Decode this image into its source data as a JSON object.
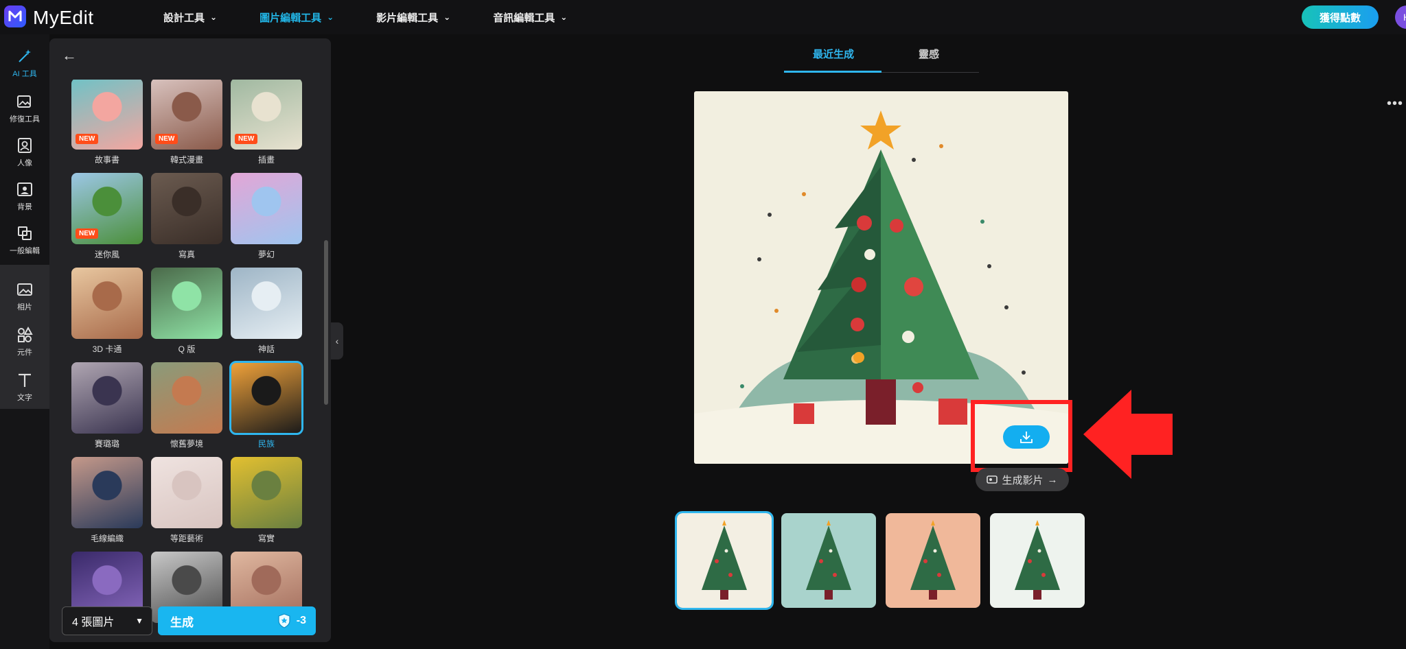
{
  "app": {
    "name": "MyEdit"
  },
  "topnav": {
    "items": [
      {
        "label": "設計工具",
        "active": false
      },
      {
        "label": "圖片編輯工具",
        "active": true
      },
      {
        "label": "影片編輯工具",
        "active": false
      },
      {
        "label": "音訊編輯工具",
        "active": false
      }
    ],
    "points_label": "獲得點數",
    "avatar_initial": "H"
  },
  "leftrail": {
    "items": [
      {
        "label": "AI 工具",
        "icon": "magic-wand-icon",
        "active": true
      },
      {
        "label": "修復工具",
        "icon": "image-repair-icon"
      },
      {
        "label": "人像",
        "icon": "portrait-icon"
      },
      {
        "label": "背景",
        "icon": "background-icon"
      },
      {
        "label": "一般編輯",
        "icon": "crop-icon"
      },
      {
        "label": "相片",
        "icon": "photo-icon"
      },
      {
        "label": "元件",
        "icon": "shapes-icon"
      },
      {
        "label": "文字",
        "icon": "text-icon"
      }
    ]
  },
  "styles": {
    "items": [
      {
        "label": "故事書",
        "new": true,
        "colors": [
          "#6fc2c6",
          "#f3a6a0"
        ]
      },
      {
        "label": "韓式漫畫",
        "new": true,
        "colors": [
          "#d9c3bf",
          "#8a5a4a"
        ]
      },
      {
        "label": "插畫",
        "new": true,
        "colors": [
          "#9fb8a0",
          "#e8e2d0"
        ]
      },
      {
        "label": "迷你風",
        "new": true,
        "colors": [
          "#9cc7e6",
          "#4b8f3a"
        ]
      },
      {
        "label": "寫真",
        "new": false,
        "colors": [
          "#6b5b50",
          "#3a2e28"
        ]
      },
      {
        "label": "夢幻",
        "new": false,
        "colors": [
          "#e3a6d6",
          "#9fc5ef"
        ]
      },
      {
        "label": "3D 卡通",
        "new": false,
        "colors": [
          "#e8c7a0",
          "#a86a4a"
        ]
      },
      {
        "label": "Q 版",
        "new": false,
        "colors": [
          "#4b6a4a",
          "#8fe3a6"
        ]
      },
      {
        "label": "神話",
        "new": false,
        "colors": [
          "#9eb5c6",
          "#e6eef3"
        ]
      },
      {
        "label": "賽璐璐",
        "new": false,
        "colors": [
          "#b0a6b2",
          "#3a3450"
        ]
      },
      {
        "label": "懷舊夢境",
        "new": false,
        "colors": [
          "#8a9b7a",
          "#c47a50"
        ]
      },
      {
        "label": "民族",
        "new": false,
        "selected": true,
        "colors": [
          "#f2a33a",
          "#1a1a1a"
        ]
      },
      {
        "label": "毛線編織",
        "new": false,
        "colors": [
          "#c5998a",
          "#2a3a5a"
        ]
      },
      {
        "label": "等距藝術",
        "new": false,
        "colors": [
          "#efe3e0",
          "#d8c4c0"
        ]
      },
      {
        "label": "寫實",
        "new": false,
        "colors": [
          "#e3c030",
          "#6a8040"
        ]
      },
      {
        "label": "",
        "new": false,
        "colors": [
          "#3a2a6a",
          "#8a6ac0"
        ]
      },
      {
        "label": "",
        "new": false,
        "colors": [
          "#c8c8c8",
          "#4a4a4a"
        ]
      },
      {
        "label": "",
        "new": false,
        "colors": [
          "#e0b8a0",
          "#a06a5a"
        ]
      }
    ]
  },
  "controls": {
    "count_label": "4 張圖片",
    "generate_label": "生成",
    "cost": "-3"
  },
  "result_tabs": [
    {
      "label": "最近生成",
      "active": true
    },
    {
      "label": "靈感",
      "active": false
    }
  ],
  "main_image": {
    "subject": "christmas-tree",
    "bg": "#f2efe0"
  },
  "video_button_label": "生成影片",
  "thumbnails": [
    {
      "bg": "#f3efe3",
      "selected": true
    },
    {
      "bg": "#a9d3cc",
      "selected": false
    },
    {
      "bg": "#f0b89a",
      "selected": false
    },
    {
      "bg": "#eef3ee",
      "selected": false
    }
  ]
}
